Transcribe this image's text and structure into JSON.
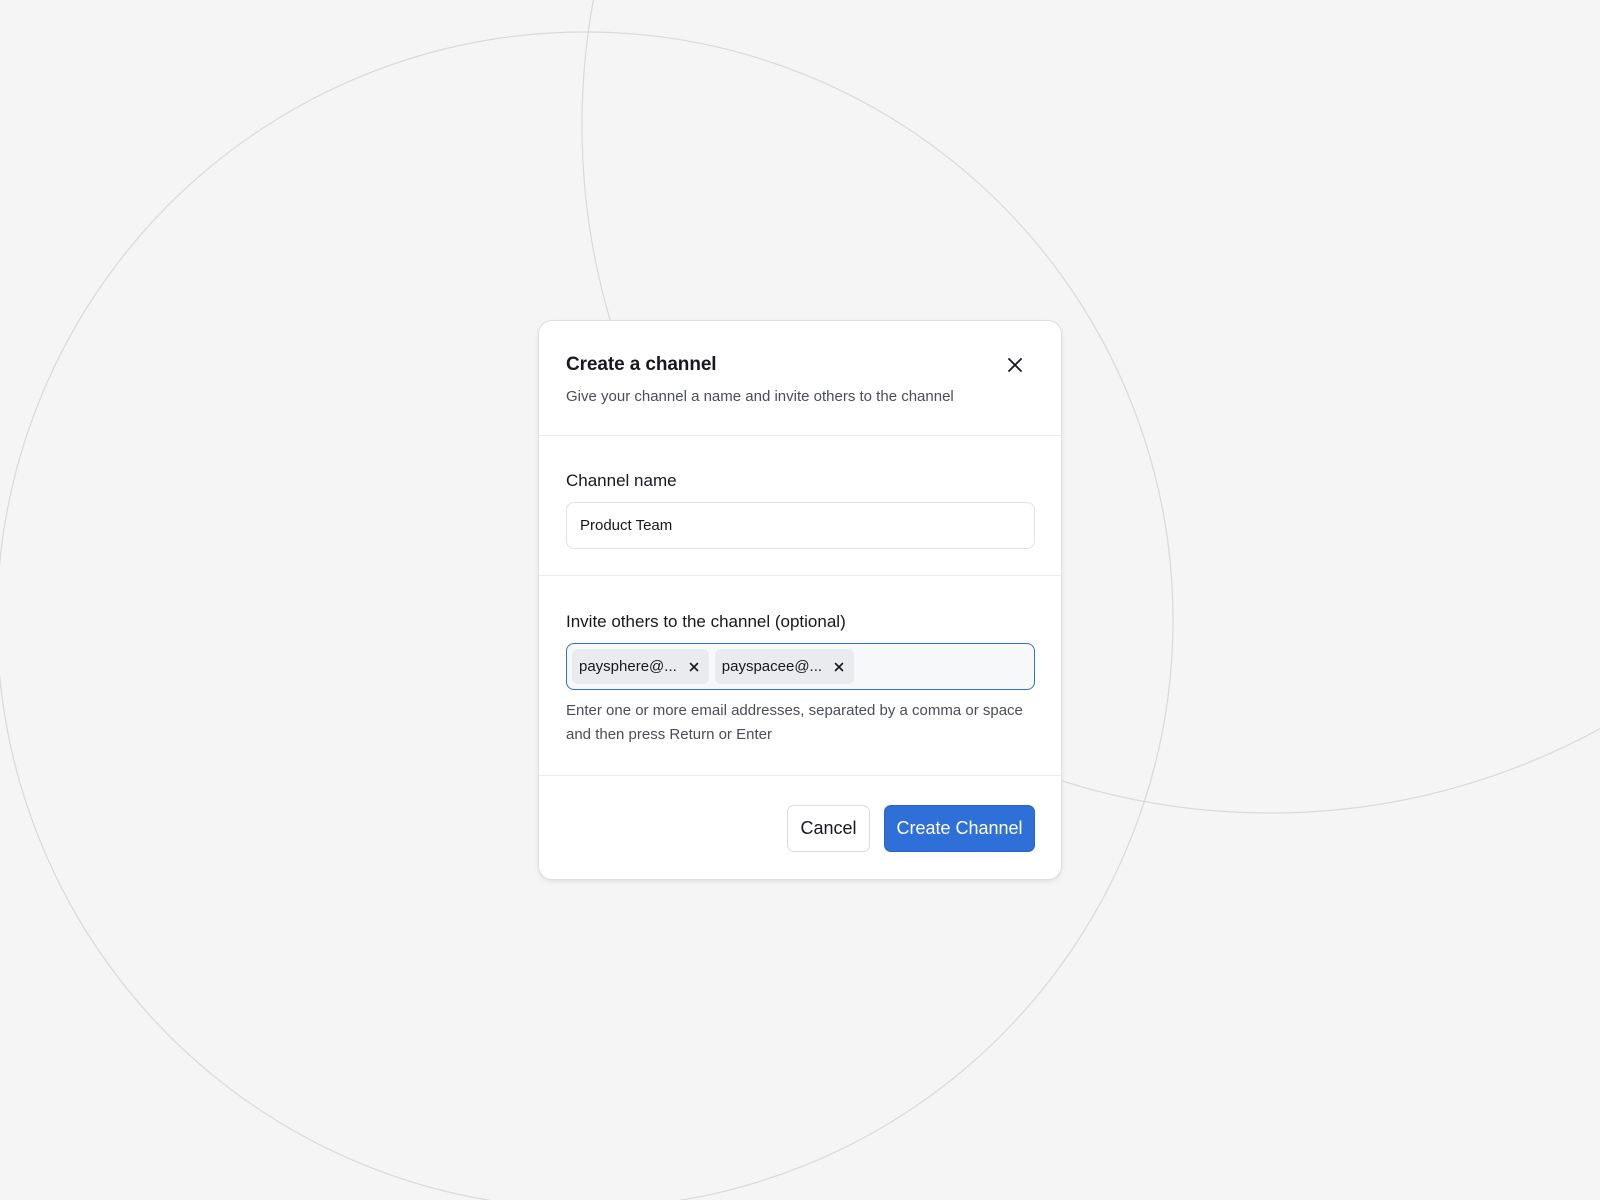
{
  "dialog": {
    "title": "Create a channel",
    "subtitle": "Give your channel a name and invite others to the channel",
    "close_icon": "close-icon"
  },
  "channel_name": {
    "label": "Channel name",
    "value": "Product Team"
  },
  "invite": {
    "label": "Invite others to the channel (optional)",
    "chips": [
      {
        "label": "paysphere@...",
        "remove_icon": "close-icon"
      },
      {
        "label": "payspacee@...",
        "remove_icon": "close-icon"
      }
    ],
    "help_text": "Enter one or more email addresses, separated by a comma or space and then press Return or Enter"
  },
  "footer": {
    "cancel_label": "Cancel",
    "submit_label": "Create Channel"
  },
  "colors": {
    "background": "#f5f5f5",
    "accent": "#2f6fd8",
    "text": "#16181d",
    "muted_text": "#4a4d55",
    "chip_bg": "#e9ebee"
  }
}
